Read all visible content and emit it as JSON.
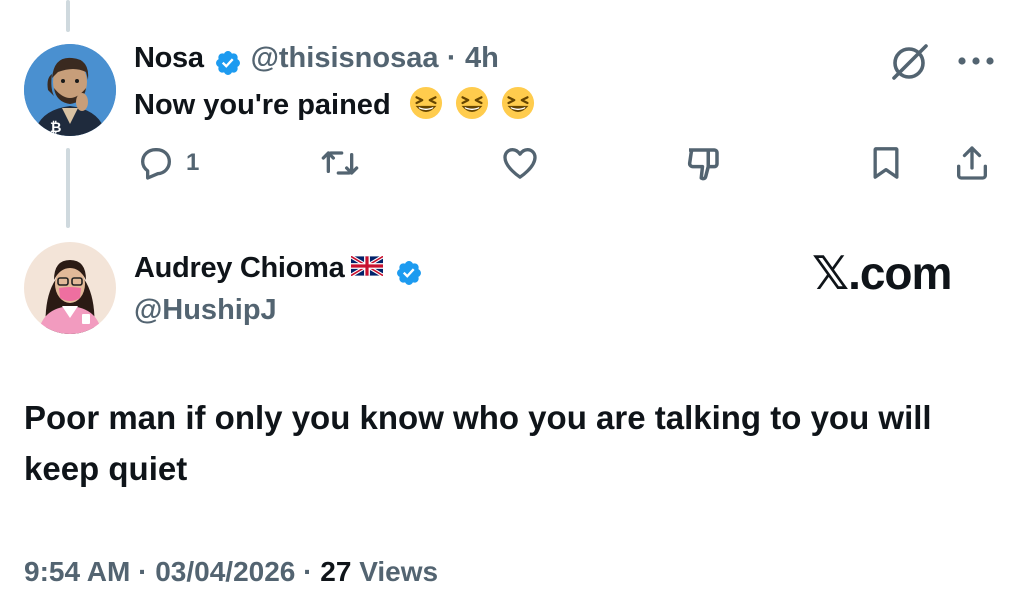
{
  "reply_tweet": {
    "author_name": "Nosa",
    "handle": "@thisisnosaa",
    "separator": "·",
    "time": "4h",
    "text": "Now you're pained",
    "actions": {
      "reply_count": "1"
    }
  },
  "main_tweet": {
    "author_name": "Audrey Chioma",
    "handle": "@HushipJ",
    "text": "Poor man if only you know who you are talking to you will keep quiet",
    "timestamp": "9:54 AM",
    "date": "03/04/2026",
    "dot": "·",
    "views_count": "27",
    "views_label": "Views"
  },
  "watermark": {
    "x_glyph": "𝕏",
    "text": ".com"
  },
  "colors": {
    "verified_blue": "#1d9bf0",
    "secondary_text": "#536471",
    "thread_line": "#cfd9de"
  }
}
